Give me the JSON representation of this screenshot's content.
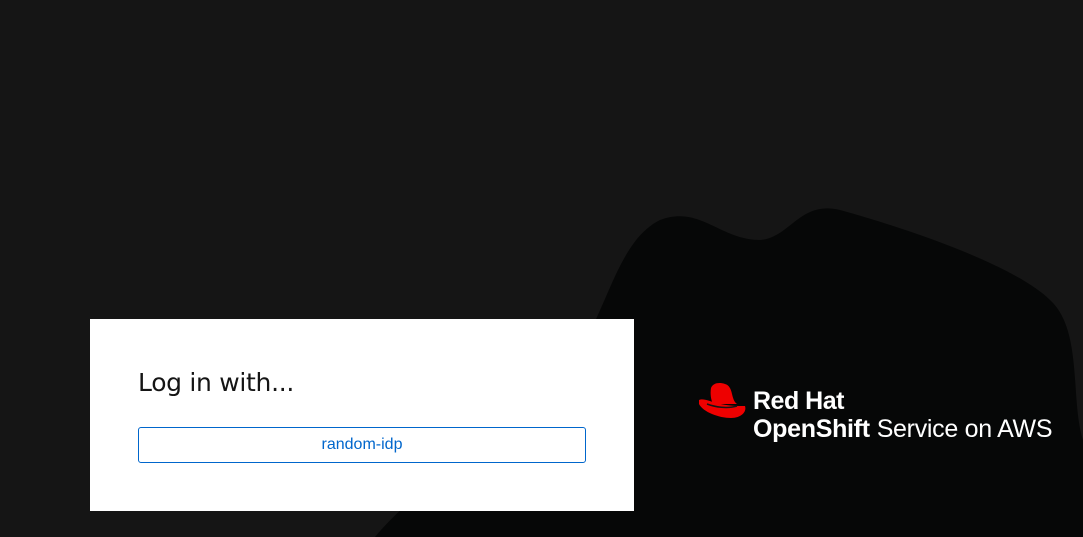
{
  "login": {
    "title": "Log in with...",
    "providers": [
      {
        "label": "random-idp"
      }
    ]
  },
  "brand": {
    "logo_icon": "red-hat-fedora-icon",
    "name": "Red Hat",
    "product_strong": "OpenShift",
    "product_rest": "Service on AWS",
    "colors": {
      "logo_red": "#ee0000",
      "text": "#ffffff"
    }
  },
  "colors": {
    "background": "#151515",
    "shape": "#060707",
    "link_blue": "#0066cc"
  }
}
